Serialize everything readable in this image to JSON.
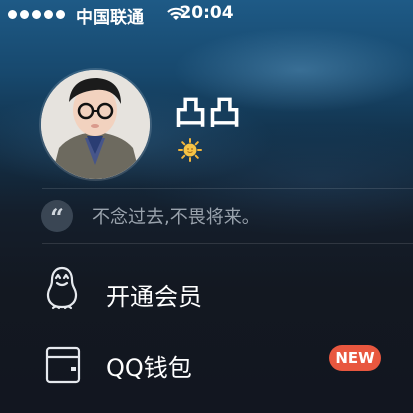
{
  "status_bar": {
    "carrier": "中国联通",
    "time": "20:04"
  },
  "profile": {
    "nickname": "凸凸",
    "signature": "不念过去,不畏将来。",
    "quote_glyph": "“"
  },
  "menu": {
    "items": [
      {
        "label": "开通会员",
        "icon": "penguin-icon"
      },
      {
        "label": "QQ钱包",
        "icon": "wallet-icon",
        "badge": "NEW"
      }
    ]
  },
  "colors": {
    "badge_new": "#e8573f",
    "sun_badge": "#f4b63a"
  }
}
